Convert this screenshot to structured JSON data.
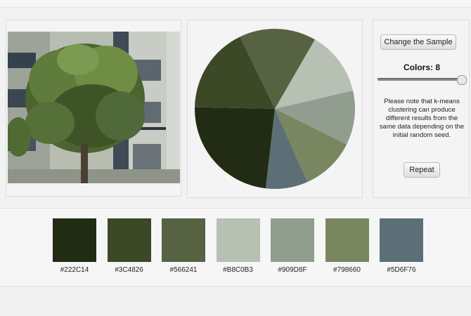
{
  "controls": {
    "change_sample_label": "Change the Sample",
    "colors_label": "Colors: 8",
    "colors_value": 8,
    "slider_level": 1.0,
    "note": "Please note that k-means clustering can produce different results from the same data depending on the initial random seed.",
    "repeat_label": "Repeat"
  },
  "pie": [
    {
      "color": "#566241",
      "fraction": 0.155
    },
    {
      "color": "#B8C0B3",
      "fraction": 0.13
    },
    {
      "color": "#909D8F",
      "fraction": 0.11
    },
    {
      "color": "#798660",
      "fraction": 0.11
    },
    {
      "color": "#5D6F76",
      "fraction": 0.085
    },
    {
      "color": "#222C14",
      "fraction": 0.235
    },
    {
      "color": "#3C4826",
      "fraction": 0.175
    }
  ],
  "swatches": [
    {
      "color": "#222C14",
      "label": "#222C14"
    },
    {
      "color": "#3C4826",
      "label": "#3C4826"
    },
    {
      "color": "#566241",
      "label": "#566241"
    },
    {
      "color": "#B8C0B3",
      "label": "#B8C0B3"
    },
    {
      "color": "#909D8F",
      "label": "#909D8F"
    },
    {
      "color": "#798660",
      "label": "#798660"
    },
    {
      "color": "#5D6F76",
      "label": "#5D6F76"
    }
  ]
}
